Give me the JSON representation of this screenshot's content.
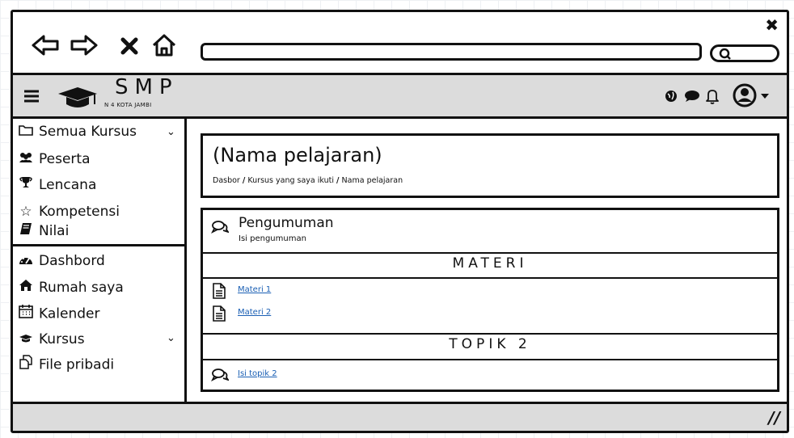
{
  "browser": {
    "close_glyph": "✖"
  },
  "app": {
    "logo_text": "SMP",
    "logo_subtitle": "N 4 KOTA JAMBI"
  },
  "sidebar": {
    "items": [
      {
        "label": "Semua Kursus",
        "icon": "folder-icon"
      },
      {
        "label": "Peserta",
        "icon": "users-icon"
      },
      {
        "label": "Lencana",
        "icon": "trophy-icon"
      },
      {
        "label": "Kompetensi",
        "icon": "star-icon"
      },
      {
        "label": "Nilai",
        "icon": "book-icon"
      },
      {
        "label": "Dashbord",
        "icon": "dashboard-icon"
      },
      {
        "label": "Rumah saya",
        "icon": "home-icon"
      },
      {
        "label": "Kalender",
        "icon": "calendar-icon"
      },
      {
        "label": "Kursus",
        "icon": "graduation-cap-icon"
      },
      {
        "label": "File pribadi",
        "icon": "files-icon"
      }
    ]
  },
  "main": {
    "title": "(Nama pelajaran)",
    "breadcrumb": [
      "Dasbor",
      "Kursus yang saya ikuti",
      "Nama pelajaran"
    ],
    "announcement": {
      "title": "Pengumuman",
      "subtitle": "Isi pengumuman"
    },
    "section1": {
      "heading": "MATERI",
      "items": [
        "Materi 1",
        "Materi 2"
      ]
    },
    "section2": {
      "heading": "TOPIK 2",
      "items": [
        "Isi topik 2"
      ]
    }
  },
  "footer": {
    "resize_glyph": "//"
  }
}
